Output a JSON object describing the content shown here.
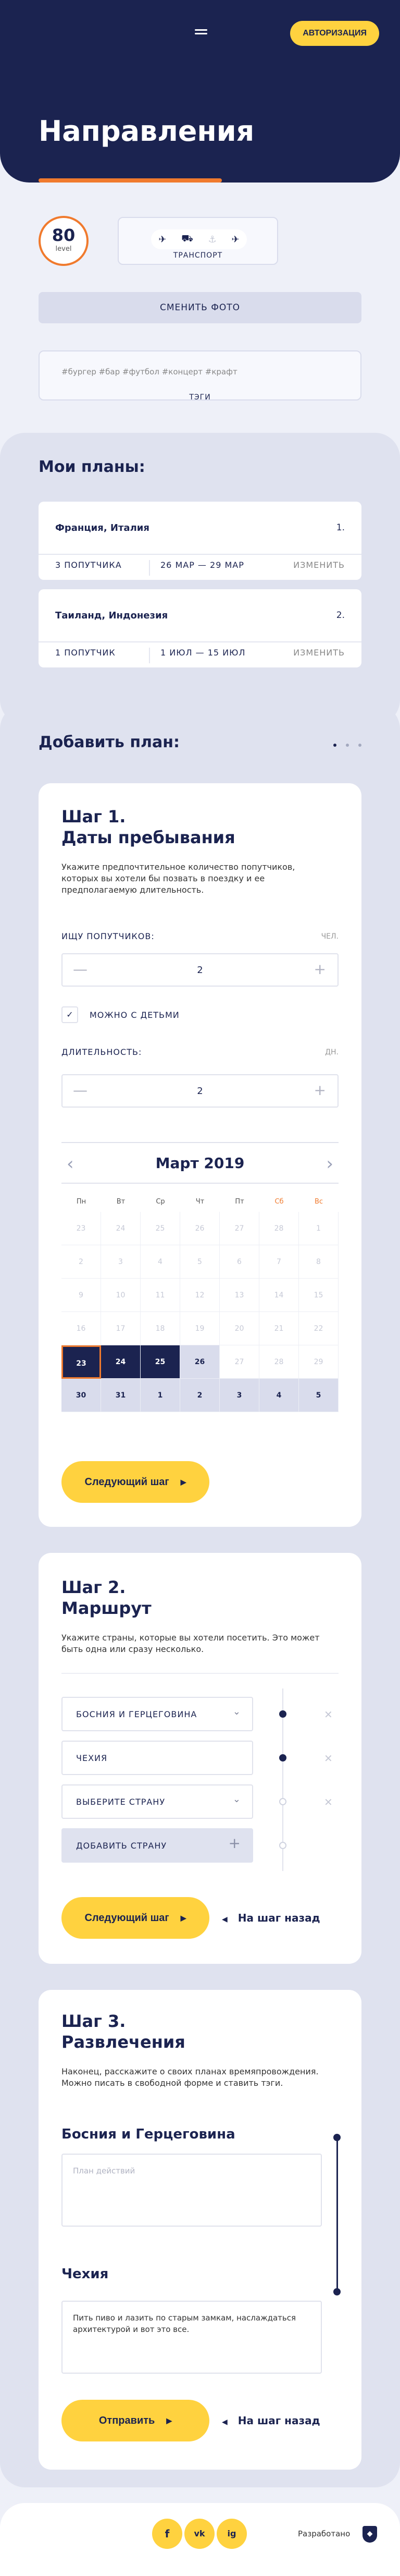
{
  "header": {
    "auth_button": "АВТОРИЗАЦИЯ",
    "title": "Направления"
  },
  "profile": {
    "level_value": "80",
    "level_label": "level",
    "transport_label": "ТРАНСПОРТ",
    "transport_icons": [
      "plane-icon",
      "car-icon",
      "ship-icon",
      "walk-icon"
    ],
    "photo_button": "СМЕНИТЬ ФОТО",
    "tags_text": "#бургер #бар #футбол #концерт #крафт",
    "tags_label": "ТЭГИ"
  },
  "my_plans": {
    "title": "Мои планы:",
    "items": [
      {
        "name": "Франция, Италия",
        "num": "1.",
        "guests": "3 ПОПУТЧИКА",
        "dates": "26 МАР — 29 МАР",
        "edit": "ИЗМЕНИТЬ"
      },
      {
        "name": "Таиланд, Индонезия",
        "num": "2.",
        "guests": "1 ПОПУТЧИК",
        "dates": "1 ИЮЛ — 15 ИЮЛ",
        "edit": "ИЗМЕНИТЬ"
      }
    ]
  },
  "add_plan": {
    "title": "Добавить план:",
    "step1": {
      "title_line1": "Шаг 1.",
      "title_line2": "Даты пребывания",
      "desc": "Укажите предпочтительное количество попутчиков, которых вы хотели бы позвать в поездку и ее предполагаемую длительность.",
      "companions_label": "ИЩУ ПОПУТЧИКОВ:",
      "companions_unit": "ЧЕЛ.",
      "companions_value": "2",
      "kids_label": "МОЖНО С ДЕТЬМИ",
      "kids_checked": true,
      "duration_label": "ДЛИТЕЛЬНОСТЬ:",
      "duration_unit": "ДН.",
      "duration_value": "2",
      "calendar": {
        "month": "Март 2019",
        "weekdays": [
          "Пн",
          "Вт",
          "Ср",
          "Чт",
          "Пт",
          "Сб",
          "Вс"
        ],
        "days": [
          "23",
          "24",
          "25",
          "26",
          "27",
          "28",
          "1",
          "2",
          "3",
          "4",
          "5",
          "6",
          "7",
          "8",
          "9",
          "10",
          "11",
          "12",
          "13",
          "14",
          "15",
          "16",
          "17",
          "18",
          "19",
          "20",
          "21",
          "22",
          "23",
          "24",
          "25",
          "26",
          "27",
          "28",
          "29",
          "30",
          "31",
          "1",
          "2",
          "3",
          "4",
          "5"
        ]
      },
      "next_button": "Следующий шаг"
    },
    "step2": {
      "title_line1": "Шаг 2.",
      "title_line2": "Маршрут",
      "desc": "Укажите страны, которые вы хотели посетить. Это может быть одна или сразу несколько.",
      "countries": [
        "БОСНИЯ И ГЕРЦЕГОВИНА",
        "ЧЕХИЯ",
        "ВЫБЕРИТЕ СТРАНУ"
      ],
      "add_country": "ДОБАВИТЬ СТРАНУ",
      "next_button": "Следующий шаг",
      "back_link": "На шаг назад"
    },
    "step3": {
      "title_line1": "Шаг 3.",
      "title_line2": "Развлечения",
      "desc": "Наконец, расскажите о своих планах времяпровождения. Можно писать в свободной форме и ставить тэги.",
      "entries": [
        {
          "country": "Босния и Герцеговина",
          "text": "",
          "placeholder": "План действий"
        },
        {
          "country": "Чехия",
          "text": "Пить пиво и лазить по старым замкам, наслаждаться архитектурой и вот это все.",
          "placeholder": ""
        }
      ],
      "submit_button": "Отправить",
      "back_link": "На шаг назад"
    }
  },
  "footer": {
    "social": [
      "f",
      "vk",
      "ig"
    ],
    "developer_label": "Разработано"
  }
}
